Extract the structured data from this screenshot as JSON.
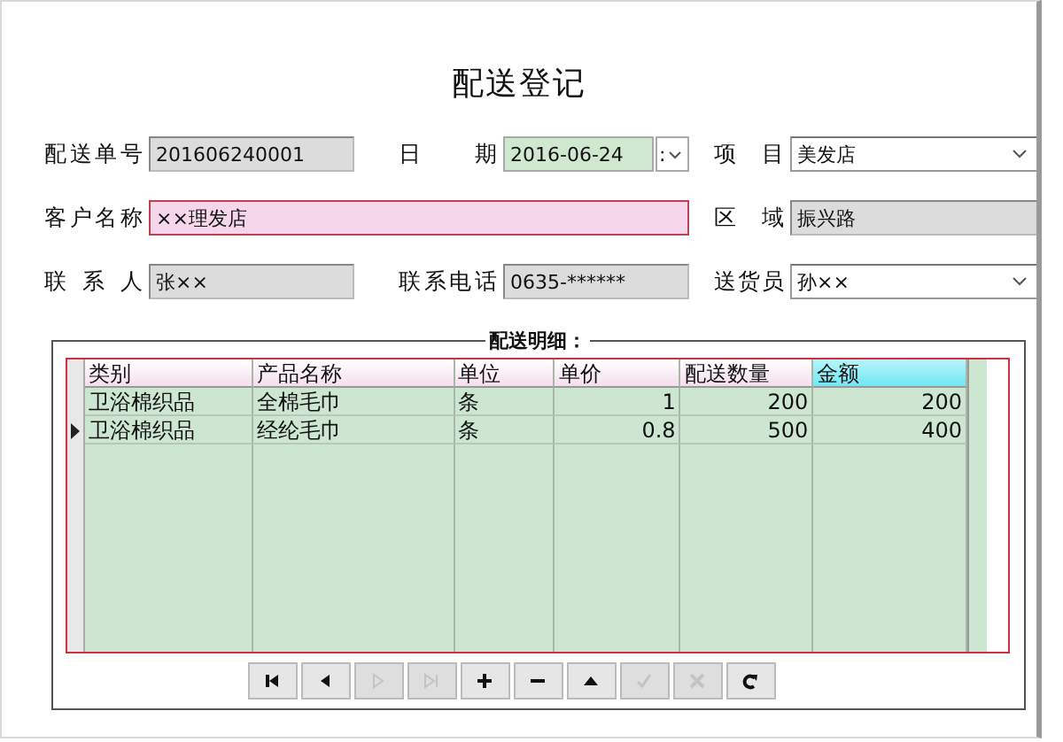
{
  "title": "配送登记",
  "form_rows": [
    [
      {
        "label": "配送单号",
        "value": "201606240001",
        "kind": "text",
        "readonly": true,
        "highlighted": false
      },
      {
        "label": "日 期",
        "value": "2016-06-24",
        "kind": "date",
        "button_text": ":"
      },
      {
        "label": "项 目",
        "value": "美发店",
        "kind": "combo",
        "readonly": false,
        "highlighted": false
      }
    ],
    [
      {
        "label": "客户名称",
        "value": "××理发店",
        "kind": "text",
        "readonly": false,
        "highlighted": true
      },
      {
        "label": "区 域",
        "value": "振兴路",
        "kind": "text",
        "readonly": true,
        "highlighted": false
      }
    ],
    [
      {
        "label": "联 系 人",
        "value": "张××",
        "kind": "text",
        "readonly": true,
        "highlighted": false
      },
      {
        "label": "联系电话",
        "value": "0635-******",
        "kind": "text",
        "readonly": true,
        "highlighted": false
      },
      {
        "label": "送货员",
        "value": "孙××",
        "kind": "combo",
        "readonly": false,
        "highlighted": false
      }
    ]
  ],
  "details": {
    "title": "配送明细：",
    "columns": [
      {
        "label": "类别",
        "selected": false
      },
      {
        "label": "产品名称",
        "selected": false
      },
      {
        "label": "单位",
        "selected": false
      },
      {
        "label": "单价",
        "selected": false
      },
      {
        "label": "配送数量",
        "selected": false
      },
      {
        "label": "金额",
        "selected": true
      }
    ],
    "rows": [
      {
        "cells": [
          "卫浴棉织品",
          "全棉毛巾",
          "条",
          "1",
          "200",
          "200"
        ],
        "selected": false
      },
      {
        "cells": [
          "卫浴棉织品",
          "经纶毛巾",
          "条",
          "0.8",
          "500",
          "400"
        ],
        "selected": true
      }
    ]
  },
  "nav_buttons": [
    {
      "kind": "first",
      "disabled": false
    },
    {
      "kind": "prev",
      "disabled": false
    },
    {
      "kind": "next",
      "disabled": true
    },
    {
      "kind": "last",
      "disabled": true
    },
    {
      "kind": "add",
      "disabled": false
    },
    {
      "kind": "delete",
      "disabled": false
    },
    {
      "kind": "up",
      "disabled": false
    },
    {
      "kind": "confirm",
      "disabled": true
    },
    {
      "kind": "cancel",
      "disabled": true
    },
    {
      "kind": "refresh",
      "disabled": false
    }
  ]
}
